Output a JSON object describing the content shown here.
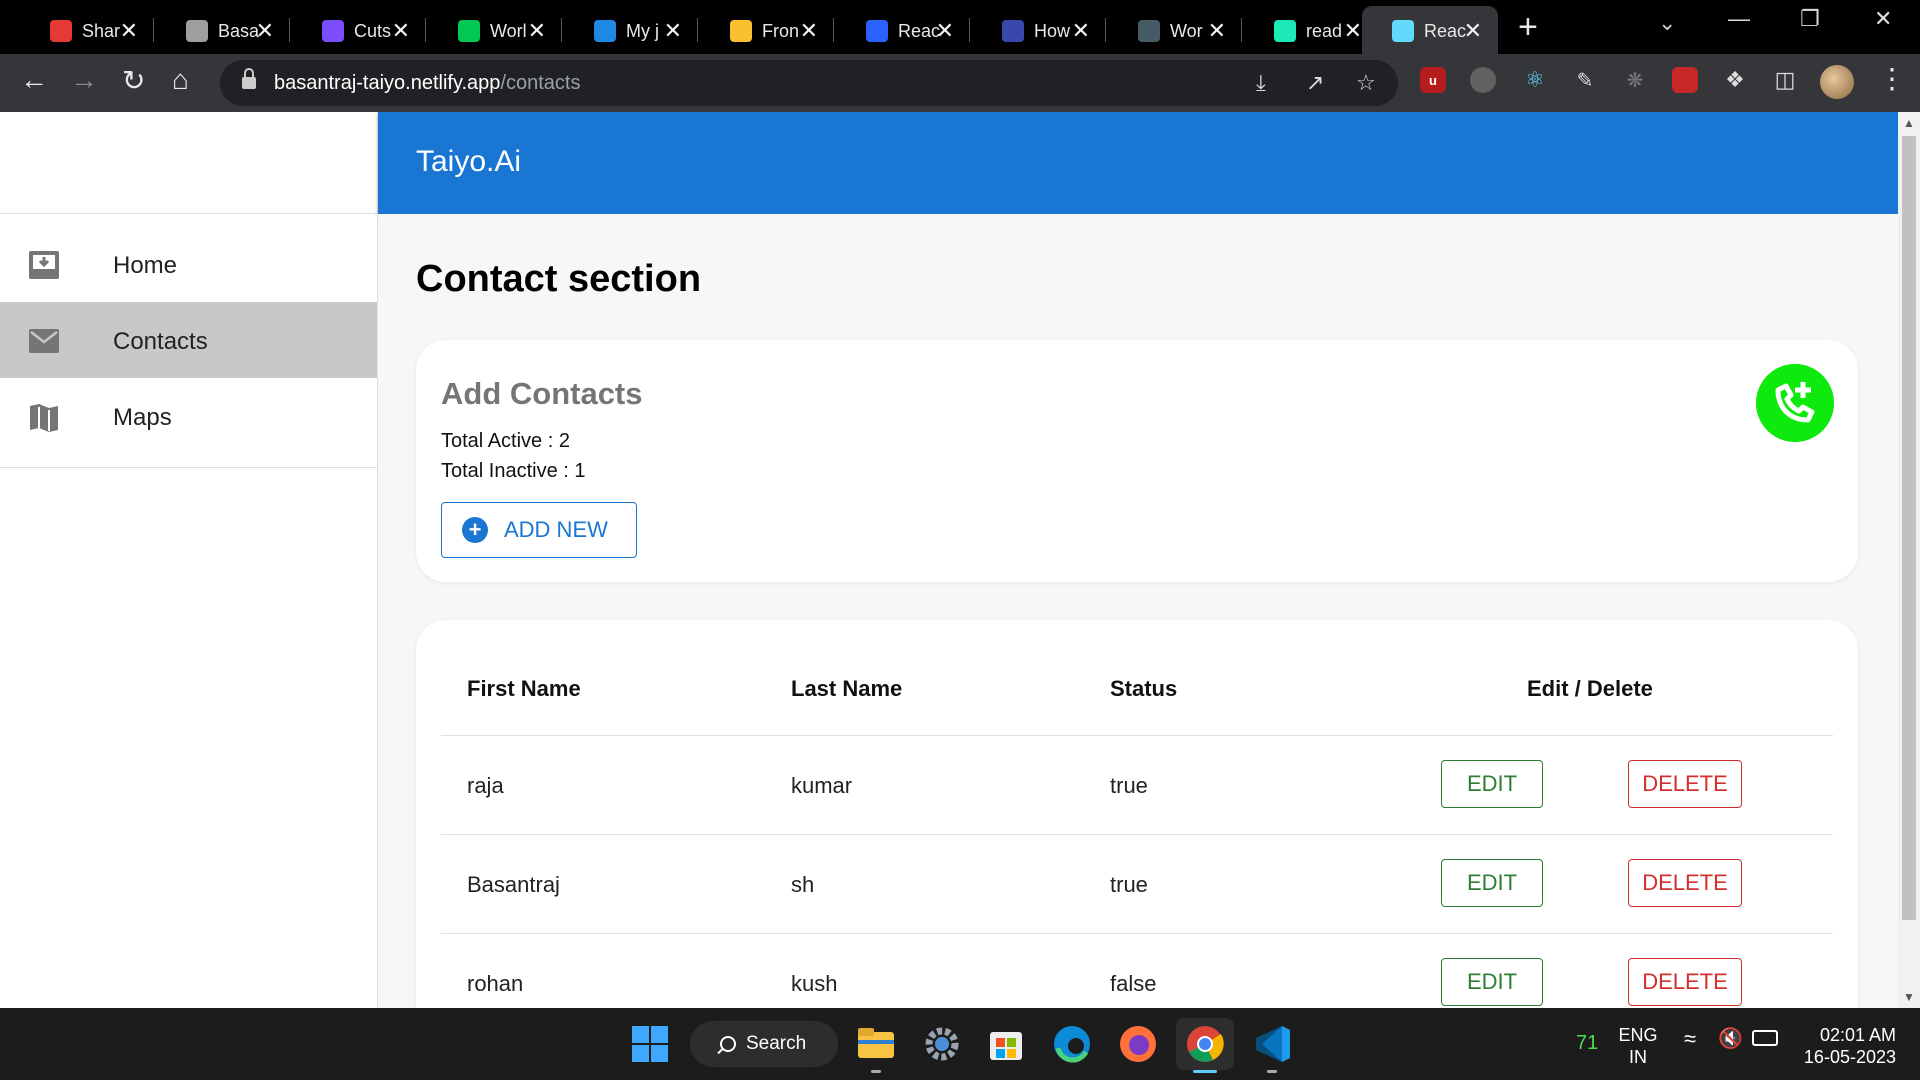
{
  "browser": {
    "tabs": [
      {
        "label": "Shar",
        "color": "#e53935"
      },
      {
        "label": "Basa",
        "color": "#9e9e9e"
      },
      {
        "label": "Cuts",
        "color": "#7c4dff"
      },
      {
        "label": "Worl",
        "color": "#00c853"
      },
      {
        "label": "My j",
        "color": "#1e88e5"
      },
      {
        "label": "Fron",
        "color": "#fbc02d"
      },
      {
        "label": "Reac",
        "color": "#2962ff"
      },
      {
        "label": "How",
        "color": "#3949ab"
      },
      {
        "label": "Wor",
        "color": "#455a64"
      },
      {
        "label": "read",
        "color": "#1de9b6"
      },
      {
        "label": "Reac",
        "color": "#61dafb"
      }
    ],
    "new_tab": "+",
    "url_host": "basantraj-taiyo.netlify.app",
    "url_path": "/contacts"
  },
  "app": {
    "brand": "Taiyo.Ai",
    "nav": [
      {
        "label": "Home",
        "icon": "inbox-download-icon"
      },
      {
        "label": "Contacts",
        "icon": "mail-icon"
      },
      {
        "label": "Maps",
        "icon": "map-icon"
      }
    ],
    "page_title": "Contact section",
    "summary": {
      "heading": "Add Contacts",
      "total_active": "Total Active : 2",
      "total_inactive": "Total Inactive : 1",
      "add_button": "ADD NEW"
    },
    "table": {
      "headers": [
        "First Name",
        "Last Name",
        "Status",
        "Edit / Delete"
      ],
      "rows": [
        {
          "first": "raja",
          "last": "kumar",
          "status": "true"
        },
        {
          "first": "Basantraj",
          "last": "sh",
          "status": "true"
        },
        {
          "first": "rohan",
          "last": "kush",
          "status": "false"
        }
      ],
      "edit_label": "EDIT",
      "delete_label": "DELETE"
    },
    "colors": {
      "primary": "#1976d2",
      "selected_nav": "#c8c8c8",
      "fab": "#0ee90e",
      "edit": "#2e7d32",
      "delete": "#d32f2f"
    }
  },
  "taskbar": {
    "search_label": "Search",
    "temperature": "71",
    "lang_line1": "ENG",
    "lang_line2": "IN",
    "time": "02:01 AM",
    "date": "16-05-2023"
  }
}
